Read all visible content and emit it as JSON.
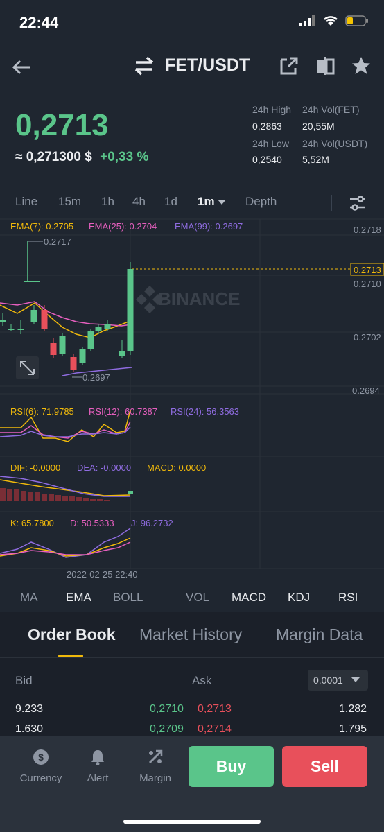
{
  "status": {
    "time": "22:44"
  },
  "header": {
    "pair": "FET/USDT"
  },
  "price": {
    "last": "0,2713",
    "approx": "≈ 0,271300 $",
    "change": "+0,33 %",
    "high_label": "24h High",
    "high_value": "0,2863",
    "vol_fet_label": "24h Vol(FET)",
    "vol_fet_value": "20,55M",
    "low_label": "24h Low",
    "low_value": "0,2540",
    "vol_usdt_label": "24h Vol(USDT)",
    "vol_usdt_value": "5,52M"
  },
  "intervals": [
    "Line",
    "15m",
    "1h",
    "4h",
    "1d",
    "1m",
    "Depth"
  ],
  "active_interval": "1m",
  "chart": {
    "ema7": "EMA(7): 0.2705",
    "ema25": "EMA(25): 0.2704",
    "ema99": "EMA(99): 0.2697",
    "y_ticks": [
      "0.2718",
      "0.2710",
      "0.2702",
      "0.2694"
    ],
    "last_price_tag": "0.2713",
    "max_mark": "0.2717",
    "min_mark": "0.2697",
    "watermark": "BINANCE",
    "rsi6": "RSI(6): 71.9785",
    "rsi12": "RSI(12): 60.7387",
    "rsi24": "RSI(24): 56.3563",
    "dif": "DIF: -0.0000",
    "dea": "DEA: -0.0000",
    "macd": "MACD: 0.0000",
    "k": "K: 65.7800",
    "d": "D: 50.5333",
    "j": "J: 96.2732",
    "time_label": "2022-02-25 22:40",
    "colors": {
      "up": "#5ac58a",
      "down": "#e8505b",
      "ema7": "#f0b90b",
      "ema25": "#e75fbf",
      "ema99": "#8f6ce0"
    }
  },
  "indicators": [
    "MA",
    "EMA",
    "BOLL",
    "VOL",
    "MACD",
    "KDJ",
    "RSI"
  ],
  "order_book": {
    "tabs": [
      "Order Book",
      "Market History",
      "Margin Data"
    ],
    "bid_label": "Bid",
    "ask_label": "Ask",
    "precision": "0.0001",
    "rows": [
      {
        "bid_qty": "9.233",
        "bid_price": "0,2710",
        "ask_price": "0,2713",
        "ask_qty": "1.282"
      },
      {
        "bid_qty": "1.630",
        "bid_price": "0,2709",
        "ask_price": "0,2714",
        "ask_qty": "1.795"
      }
    ]
  },
  "bottom": {
    "currency": "Currency",
    "alert": "Alert",
    "margin": "Margin",
    "buy": "Buy",
    "sell": "Sell"
  }
}
